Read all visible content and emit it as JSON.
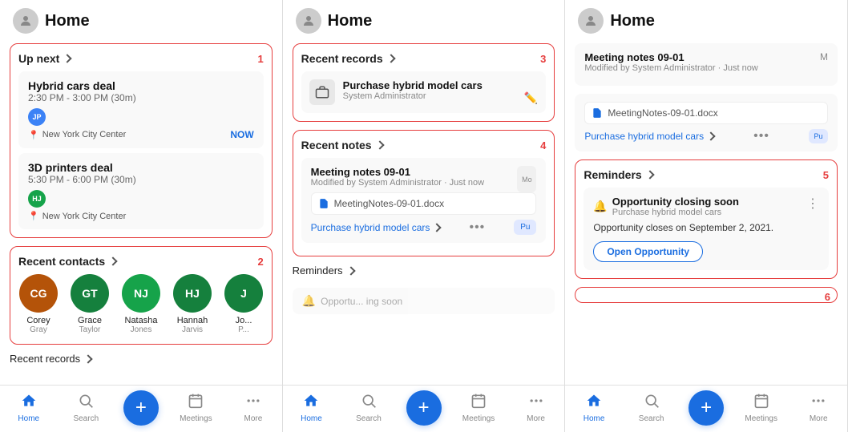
{
  "panels": [
    {
      "id": "panel1",
      "header": {
        "title": "Home",
        "avatar": "person"
      },
      "sections": [
        {
          "id": "up-next",
          "title": "Up next",
          "number": "1",
          "events": [
            {
              "title": "Hybrid cars deal",
              "time": "2:30 PM - 3:00 PM (30m)",
              "userInitials": "JP",
              "userColor": "#3b82f6",
              "location": "New York City Center",
              "badge": "NOW"
            },
            {
              "title": "3D printers deal",
              "time": "5:30 PM - 6:00 PM (30m)",
              "userInitials": "HJ",
              "userColor": "#16a34a",
              "location": "New York City Center",
              "badge": ""
            }
          ]
        },
        {
          "id": "recent-contacts",
          "title": "Recent contacts",
          "number": "2",
          "contacts": [
            {
              "initials": "CG",
              "name": "Corey",
              "surname": "Gray",
              "color": "#b45309"
            },
            {
              "initials": "GT",
              "name": "Grace",
              "surname": "Taylor",
              "color": "#15803d"
            },
            {
              "initials": "NJ",
              "name": "Natasha",
              "surname": "Jones",
              "color": "#16a34a"
            },
            {
              "initials": "HJ",
              "name": "Hannah",
              "surname": "Jarvis",
              "color": "#15803d"
            },
            {
              "initials": "J",
              "name": "Jo...",
              "surname": "P...",
              "color": "#15803d"
            }
          ]
        },
        {
          "id": "recent-records-mini",
          "title": "Recent records"
        }
      ],
      "nav": {
        "items": [
          {
            "icon": "home",
            "label": "Home",
            "active": true
          },
          {
            "icon": "search",
            "label": "Search",
            "active": false
          },
          {
            "icon": "calendar",
            "label": "Meetings",
            "active": false
          },
          {
            "icon": "more",
            "label": "More",
            "active": false
          }
        ]
      }
    },
    {
      "id": "panel2",
      "header": {
        "title": "Home",
        "avatar": "person"
      },
      "sections": [
        {
          "id": "recent-records",
          "title": "Recent records",
          "number": "3",
          "record": {
            "title": "Purchase hybrid model cars",
            "subtitle": "System Administrator",
            "icon": "briefcase"
          }
        },
        {
          "id": "recent-notes",
          "title": "Recent notes",
          "number": "4",
          "note": {
            "title": "Meeting notes 09-01",
            "subtitle": "Modified by System Administrator · Just now",
            "file": "MeetingNotes-09-01.docx",
            "link": "Purchase hybrid model cars",
            "rightBadge": "Pu"
          }
        },
        {
          "id": "reminders",
          "title": "Reminders"
        }
      ],
      "nav": {
        "items": [
          {
            "icon": "home",
            "label": "Home",
            "active": true
          },
          {
            "icon": "search",
            "label": "Search",
            "active": false
          },
          {
            "icon": "calendar",
            "label": "Meetings",
            "active": false
          },
          {
            "icon": "more",
            "label": "More",
            "active": false
          }
        ]
      }
    },
    {
      "id": "panel3",
      "header": {
        "title": "Home",
        "avatar": "person"
      },
      "sections": [
        {
          "id": "meeting-notes-top",
          "noteTitle": "Meeting notes 09-01",
          "noteSubtitle": "Modified by System Administrator · Just now",
          "rightText": "M"
        },
        {
          "id": "file-section",
          "file": "MeetingNotes-09-01.docx",
          "link": "Purchase hybrid model cars"
        },
        {
          "id": "reminders-section",
          "title": "Reminders",
          "number": "5",
          "reminder": {
            "title": "Opportunity closing soon",
            "subtitle": "Purchase hybrid model cars",
            "description": "Opportunity closes on September 2, 2021.",
            "buttonLabel": "Open Opportunity"
          }
        },
        {
          "id": "section6",
          "number": "6"
        }
      ],
      "nav": {
        "items": [
          {
            "icon": "home",
            "label": "Home",
            "active": true
          },
          {
            "icon": "search",
            "label": "Search",
            "active": false
          },
          {
            "icon": "calendar",
            "label": "Meetings",
            "active": false
          },
          {
            "icon": "more",
            "label": "More",
            "active": false
          }
        ]
      }
    }
  ],
  "icons": {
    "home": "⌂",
    "search": "🔍",
    "calendar": "▦",
    "more": "•••",
    "location": "📍",
    "briefcase": "💼",
    "file": "📄",
    "bell": "🔔",
    "pencil": "✏️",
    "plus": "+"
  }
}
